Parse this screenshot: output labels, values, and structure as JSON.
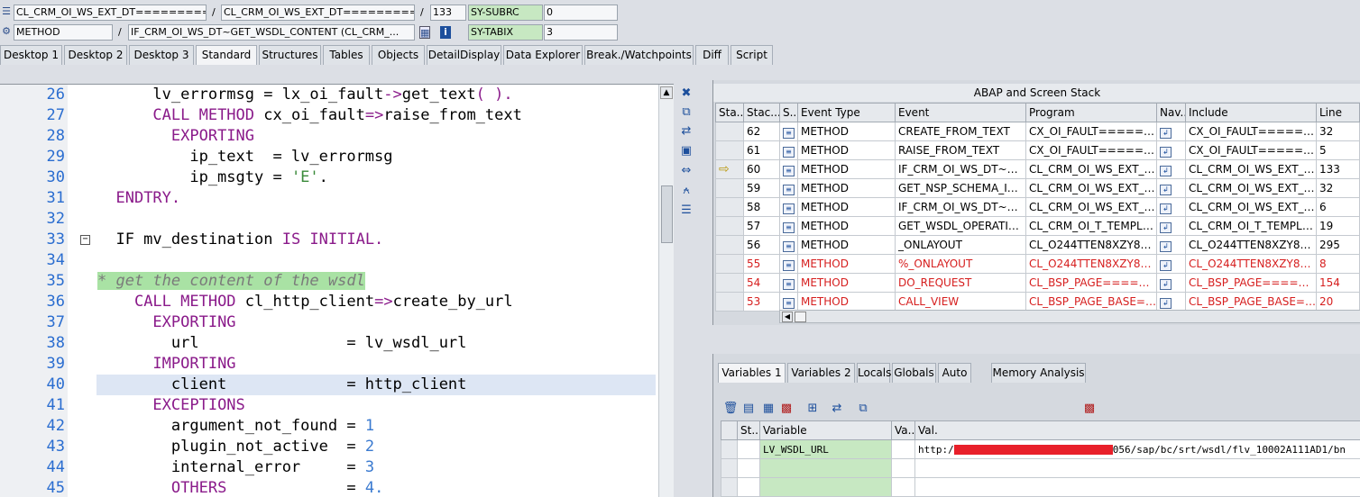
{
  "header": {
    "row1": {
      "program": "CL_CRM_OI_WS_EXT_DT==========",
      "sep1": "/",
      "include": "CL_CRM_OI_WS_EXT_DT==========",
      "sep2": "/",
      "line": "133",
      "sysfield": "SY-SUBRC",
      "sysvalue": "0"
    },
    "row2": {
      "event_type": "METHOD",
      "sep1": "/",
      "event": "IF_CRM_OI_WS_DT~GET_WSDL_CONTENT (CL_CRM_...",
      "sysfield": "SY-TABIX",
      "sysvalue": "3"
    }
  },
  "tabs": [
    {
      "label": "Desktop 1"
    },
    {
      "label": "Desktop 2"
    },
    {
      "label": "Desktop 3"
    },
    {
      "label": "Standard"
    },
    {
      "label": "Structures"
    },
    {
      "label": "Tables"
    },
    {
      "label": "Objects"
    },
    {
      "label": "DetailDisplay"
    },
    {
      "label": "Data Explorer"
    },
    {
      "label": "Break./Watchpoints"
    },
    {
      "label": "Diff"
    },
    {
      "label": "Script"
    }
  ],
  "active_tab": "Standard",
  "code": {
    "lines": [
      {
        "num": "26",
        "parts": [
          {
            "t": "      lv_errormsg = lx_oi_fault",
            "c": ""
          },
          {
            "t": "->",
            "c": "kw"
          },
          {
            "t": "get_text",
            "c": ""
          },
          {
            "t": "( ).",
            "c": "kw"
          }
        ]
      },
      {
        "num": "27",
        "parts": [
          {
            "t": "      ",
            "c": ""
          },
          {
            "t": "CALL METHOD",
            "c": "kw"
          },
          {
            "t": " cx_oi_fault",
            "c": ""
          },
          {
            "t": "=>",
            "c": "kw"
          },
          {
            "t": "raise_from_text",
            "c": ""
          }
        ]
      },
      {
        "num": "28",
        "parts": [
          {
            "t": "        ",
            "c": ""
          },
          {
            "t": "EXPORTING",
            "c": "kw"
          }
        ]
      },
      {
        "num": "29",
        "parts": [
          {
            "t": "          ip_text  = lv_errormsg",
            "c": ""
          }
        ]
      },
      {
        "num": "30",
        "parts": [
          {
            "t": "          ip_msgty = ",
            "c": ""
          },
          {
            "t": "'E'",
            "c": "str"
          },
          {
            "t": ".",
            "c": ""
          }
        ]
      },
      {
        "num": "31",
        "parts": [
          {
            "t": "  ",
            "c": ""
          },
          {
            "t": "ENDTRY.",
            "c": "kw"
          }
        ]
      },
      {
        "num": "32",
        "parts": [
          {
            "t": "",
            "c": ""
          }
        ]
      },
      {
        "num": "33",
        "parts": [
          {
            "t": "  IF mv_destination ",
            "c": ""
          },
          {
            "t": "IS INITIAL.",
            "c": "kw"
          }
        ]
      },
      {
        "num": "34",
        "parts": [
          {
            "t": "",
            "c": ""
          }
        ]
      },
      {
        "num": "35",
        "parts": [
          {
            "t": "* get the content of the wsdl",
            "c": "cm cmbg"
          }
        ]
      },
      {
        "num": "36",
        "parts": [
          {
            "t": "    ",
            "c": ""
          },
          {
            "t": "CALL METHOD",
            "c": "kw"
          },
          {
            "t": " cl_http_client",
            "c": ""
          },
          {
            "t": "=>",
            "c": "kw"
          },
          {
            "t": "create_by_url",
            "c": ""
          }
        ]
      },
      {
        "num": "37",
        "parts": [
          {
            "t": "      ",
            "c": ""
          },
          {
            "t": "EXPORTING",
            "c": "kw"
          }
        ]
      },
      {
        "num": "38",
        "parts": [
          {
            "t": "        url                = lv_wsdl_url",
            "c": ""
          }
        ]
      },
      {
        "num": "39",
        "parts": [
          {
            "t": "      ",
            "c": ""
          },
          {
            "t": "IMPORTING",
            "c": "kw"
          }
        ]
      },
      {
        "num": "40",
        "parts": [
          {
            "t": "        client             = http_client",
            "c": ""
          }
        ]
      },
      {
        "num": "41",
        "parts": [
          {
            "t": "      ",
            "c": ""
          },
          {
            "t": "EXCEPTIONS",
            "c": "kw"
          }
        ]
      },
      {
        "num": "42",
        "parts": [
          {
            "t": "        argument_not_found = ",
            "c": ""
          },
          {
            "t": "1",
            "c": "num"
          }
        ]
      },
      {
        "num": "43",
        "parts": [
          {
            "t": "        plugin_not_active  = ",
            "c": ""
          },
          {
            "t": "2",
            "c": "num"
          }
        ]
      },
      {
        "num": "44",
        "parts": [
          {
            "t": "        internal_error     = ",
            "c": ""
          },
          {
            "t": "3",
            "c": "num"
          }
        ]
      },
      {
        "num": "45",
        "parts": [
          {
            "t": "        ",
            "c": ""
          },
          {
            "t": "OTHERS",
            "c": "kw"
          },
          {
            "t": "             = ",
            "c": ""
          },
          {
            "t": "4.",
            "c": "num"
          }
        ]
      }
    ],
    "highlight_line": "40",
    "fold_lines": [
      "33"
    ]
  },
  "stack": {
    "title": "ABAP and Screen Stack",
    "columns": [
      "Sta...",
      "Stac...",
      "S...",
      "Event Type",
      "Event",
      "Program",
      "Nav...",
      "Include",
      "Line"
    ],
    "rows": [
      {
        "status": "",
        "stack": "62",
        "event_type": "METHOD",
        "event": "CREATE_FROM_TEXT",
        "program": "CX_OI_FAULT=======...",
        "include": "CX_OI_FAULT=======...",
        "line": "32",
        "red": false
      },
      {
        "status": "",
        "stack": "61",
        "event_type": "METHOD",
        "event": "RAISE_FROM_TEXT",
        "program": "CX_OI_FAULT=======...",
        "include": "CX_OI_FAULT=======...",
        "line": "5",
        "red": false
      },
      {
        "status": "arrow",
        "stack": "60",
        "event_type": "METHOD",
        "event": "IF_CRM_OI_WS_DT~GE...",
        "program": "CL_CRM_OI_WS_EXT_D...",
        "include": "CL_CRM_OI_WS_EXT_D...",
        "line": "133",
        "red": false
      },
      {
        "status": "",
        "stack": "59",
        "event_type": "METHOD",
        "event": "GET_NSP_SCHEMA_INF...",
        "program": "CL_CRM_OI_WS_EXT_D...",
        "include": "CL_CRM_OI_WS_EXT_D...",
        "line": "32",
        "red": false
      },
      {
        "status": "",
        "stack": "58",
        "event_type": "METHOD",
        "event": "IF_CRM_OI_WS_DT~GE...",
        "program": "CL_CRM_OI_WS_EXT_D...",
        "include": "CL_CRM_OI_WS_EXT_D...",
        "line": "6",
        "red": false
      },
      {
        "status": "",
        "stack": "57",
        "event_type": "METHOD",
        "event": "GET_WSDL_OPERATION...",
        "program": "CL_CRM_OI_T_TEMPLA...",
        "include": "CL_CRM_OI_T_TEMPLA...",
        "line": "19",
        "red": false
      },
      {
        "status": "",
        "stack": "56",
        "event_type": "METHOD",
        "event": "_ONLAYOUT",
        "program": "CL_O244TTEN8XZY8UW...",
        "include": "CL_O244TTEN8XZY8UW...",
        "line": "295",
        "red": false
      },
      {
        "status": "",
        "stack": "55",
        "event_type": "METHOD",
        "event": "%_ONLAYOUT",
        "program": "CL_O244TTEN8XZY8UW...",
        "include": "CL_O244TTEN8XZY8UW...",
        "line": "8",
        "red": true
      },
      {
        "status": "",
        "stack": "54",
        "event_type": "METHOD",
        "event": "DO_REQUEST",
        "program": "CL_BSP_PAGE=======...",
        "include": "CL_BSP_PAGE=======...",
        "line": "154",
        "red": true
      },
      {
        "status": "",
        "stack": "53",
        "event_type": "METHOD",
        "event": "CALL_VIEW",
        "program": "CL_BSP_PAGE_BASE==...",
        "include": "CL_BSP_PAGE_BASE==...",
        "line": "20",
        "red": true
      }
    ]
  },
  "variables": {
    "tabs": [
      "Variables 1",
      "Variables 2",
      "Locals",
      "Globals",
      "Auto",
      "Memory Analysis"
    ],
    "active_tab": "Variables 1",
    "columns": [
      "St...",
      "Variable",
      "Va...",
      "Val."
    ],
    "rows": [
      {
        "variable": "LV_WSDL_URL",
        "value_prefix": "http:/",
        "value_suffix": "056/sap/bc/srt/wsdl/flv_10002A111AD1/bn"
      },
      {
        "variable": "",
        "value_prefix": "",
        "value_suffix": ""
      },
      {
        "variable": "",
        "value_prefix": "",
        "value_suffix": ""
      }
    ]
  },
  "colors": {
    "keyword": "#8a1a8a",
    "string": "#3a8a3a",
    "number": "#3a7ad0",
    "line_number": "#2a6dd0",
    "comment_bg": "#a9e2a4",
    "error_row": "#d61e1e",
    "field_green": "#c7e8c2",
    "redaction": "#e8202a"
  }
}
